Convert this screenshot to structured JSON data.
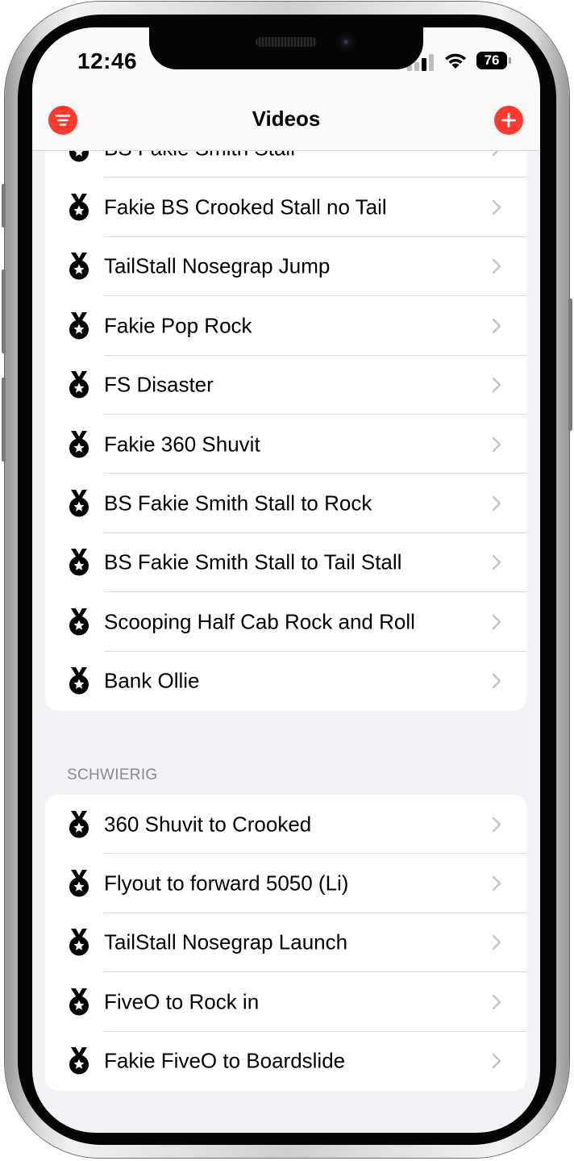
{
  "status_bar": {
    "time": "12:46",
    "battery": "76"
  },
  "nav": {
    "title": "Videos",
    "left_icon": "filter-icon",
    "right_icon": "plus-icon"
  },
  "colors": {
    "accent": "#ff3b30",
    "background": "#f2f2f7",
    "chevron": "#c4c4c7",
    "secondary_text": "#8a8a8e"
  },
  "groups": [
    {
      "header": "",
      "items": [
        {
          "label": "BS Fakie Smith Stall",
          "icon": "medal-icon"
        },
        {
          "label": "Fakie BS Crooked Stall no Tail",
          "icon": "medal-icon"
        },
        {
          "label": "TailStall Nosegrap Jump",
          "icon": "medal-icon"
        },
        {
          "label": "Fakie Pop Rock",
          "icon": "medal-icon"
        },
        {
          "label": "FS Disaster",
          "icon": "medal-icon"
        },
        {
          "label": "Fakie 360 Shuvit",
          "icon": "medal-icon"
        },
        {
          "label": "BS Fakie Smith Stall to Rock",
          "icon": "medal-icon"
        },
        {
          "label": "BS Fakie Smith Stall to Tail Stall",
          "icon": "medal-icon"
        },
        {
          "label": "Scooping Half Cab Rock and Roll",
          "icon": "medal-icon"
        },
        {
          "label": "Bank Ollie",
          "icon": "medal-icon"
        }
      ]
    },
    {
      "header": "SCHWIERIG",
      "items": [
        {
          "label": "360 Shuvit to Crooked",
          "icon": "medal-icon"
        },
        {
          "label": "Flyout to forward 5050 (Li)",
          "icon": "medal-icon"
        },
        {
          "label": "TailStall Nosegrap Launch",
          "icon": "medal-icon"
        },
        {
          "label": "FiveO to Rock in",
          "icon": "medal-icon"
        },
        {
          "label": "Fakie FiveO to Boardslide",
          "icon": "medal-icon"
        }
      ]
    }
  ]
}
